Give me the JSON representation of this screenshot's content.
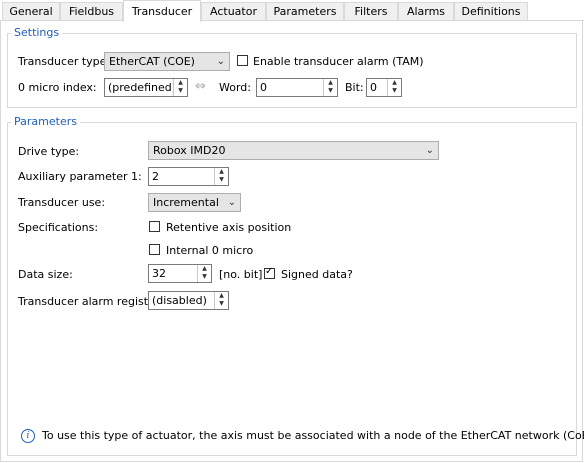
{
  "tabs": [
    "General",
    "Fieldbus",
    "Transducer",
    "Actuator",
    "Parameters",
    "Filters",
    "Alarms",
    "Definitions"
  ],
  "active_tab": "Transducer",
  "settings": {
    "title": "Settings",
    "transducer_type_label": "Transducer type:",
    "transducer_type_value": "EtherCAT (COE)",
    "enable_alarm_label": "Enable transducer alarm (TAM)",
    "zero_micro_label": "0 micro index:",
    "zero_micro_value": "(predefined)",
    "word_label": "Word:",
    "word_value": "0",
    "bit_label": "Bit:",
    "bit_value": "0"
  },
  "parameters": {
    "title": "Parameters",
    "drive_type_label": "Drive type:",
    "drive_type_value": "Robox IMD20",
    "aux_param_label": "Auxiliary parameter 1:",
    "aux_param_value": "2",
    "transducer_use_label": "Transducer use:",
    "transducer_use_value": "Incremental",
    "specifications_label": "Specifications:",
    "retentive_label": "Retentive axis position",
    "internal_zero_label": "Internal 0 micro",
    "data_size_label": "Data size:",
    "data_size_value": "32",
    "data_size_unit": "[no. bit]",
    "signed_label": "Signed data?",
    "signed_checked": true,
    "alarm_register_label": "Transducer alarm register:",
    "alarm_register_value": "(disabled)"
  },
  "info_text": "To use this type of actuator, the axis must be associated with a node of the EtherCAT network (CoE).",
  "colors": {
    "accent": "#1f5fb8"
  }
}
